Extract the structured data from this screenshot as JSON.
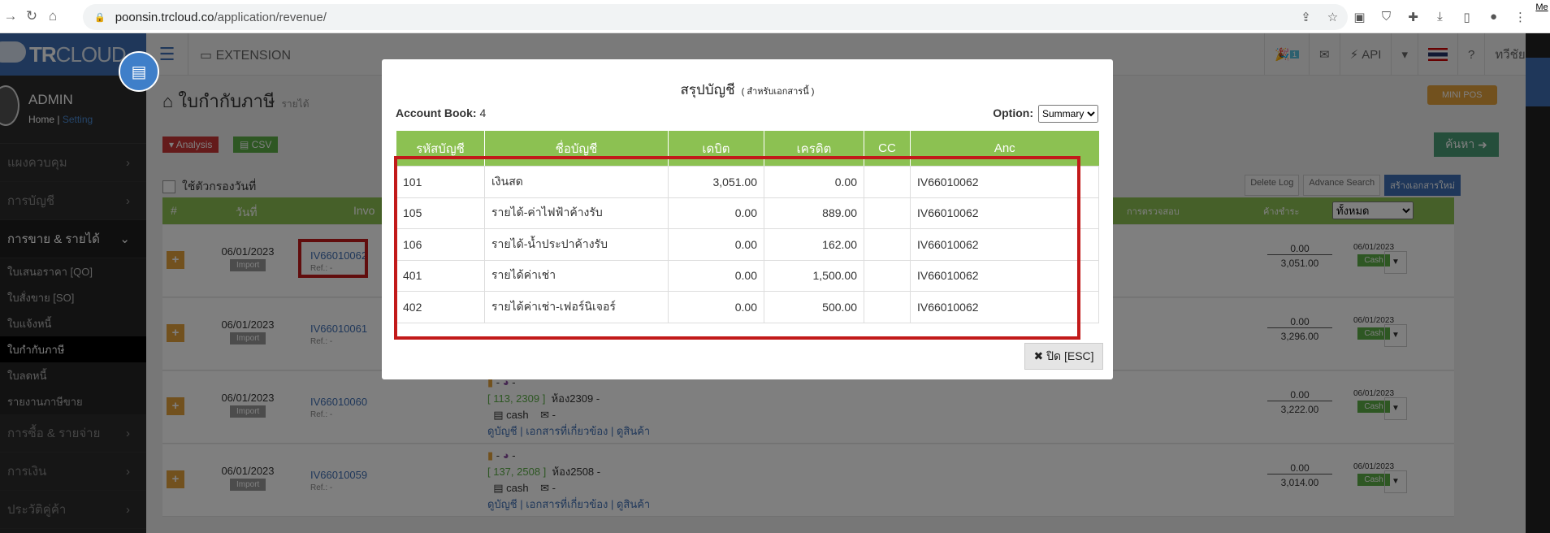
{
  "browser": {
    "url_host": "poonsin.trcloud.co",
    "url_path": "/application/revenue/",
    "me": "Me"
  },
  "app": {
    "logo_a": "TR",
    "logo_b": "CLOUD",
    "user": "ADMIN",
    "home": "Home",
    "setting": "Setting",
    "extension": "EXTENSION",
    "api": "API",
    "lang_user": "ทวีชัย",
    "badge": "1"
  },
  "sidebar": {
    "items": [
      "แผงควบคุม",
      "การบัญชี",
      "การขาย & รายได้"
    ],
    "subs": [
      "ใบเสนอราคา [QO]",
      "ใบสั่งขาย [SO]",
      "ใบแจ้งหนี้",
      "ใบกำกับภาษี",
      "ใบลดหนี้",
      "รายงานภาษีขาย"
    ],
    "items2": [
      "การซื้อ & รายจ่าย",
      "การเงิน",
      "ประวัติคู่ค้า"
    ]
  },
  "page": {
    "title": "ใบกำกับภาษี",
    "subtitle": "รายได้",
    "mini_pos": "MINI POS",
    "analysis": "Analysis",
    "csv": "CSV",
    "search": "ค้นหา",
    "date_filter": "ใช้ตัวกรองวันที่",
    "delete_log": "Delete Log",
    "adv_search": "Advance Search",
    "create": "สร้างเอกสารใหม่",
    "filter_all": "ทั้งหมด"
  },
  "table_head": {
    "hash": "#",
    "date": "วันที่",
    "inv": "Invo",
    "audit": "การตรวจสอบ",
    "due": "ค้างชำระ"
  },
  "rows": [
    {
      "date": "06/01/2023",
      "status": "Import",
      "inv": "IV66010062",
      "ref": "Ref.: -",
      "a": "0.00",
      "b": "3,051.00",
      "rdate": "06/01/2023",
      "pay": "Cash"
    },
    {
      "date": "06/01/2023",
      "status": "Import",
      "inv": "IV66010061",
      "ref": "Ref.: -",
      "a": "0.00",
      "b": "3,296.00",
      "rdate": "06/01/2023",
      "pay": "Cash"
    },
    {
      "date": "06/01/2023",
      "status": "Import",
      "inv": "IV66010060",
      "ref": "Ref.: -",
      "a": "0.00",
      "b": "3,222.00",
      "rdate": "06/01/2023",
      "pay": "Cash",
      "room": "[ 113, 2309 ]",
      "roomname": "ห้อง2309 -",
      "cash": "cash",
      "links": "ดูบัญชี | เอกสารที่เกี่ยวข้อง | ดูสินค้า"
    },
    {
      "date": "06/01/2023",
      "status": "Import",
      "inv": "IV66010059",
      "ref": "Ref.: -",
      "a": "0.00",
      "b": "3,014.00",
      "rdate": "06/01/2023",
      "pay": "Cash",
      "room": "[ 137, 2508 ]",
      "roomname": "ห้อง2508 -",
      "cash": "cash",
      "links": "ดูบัญชี | เอกสารที่เกี่ยวข้อง | ดูสินค้า"
    }
  ],
  "modal": {
    "title": "สรุปบัญชี",
    "title_note": "( สำหรับเอกสารนี้ )",
    "book_label": "Account Book:",
    "book_value": "4",
    "option_label": "Option:",
    "option_value": "Summary",
    "headers": [
      "รหัสบัญชี",
      "ชื่อบัญชี",
      "เดบิต",
      "เครดิต",
      "CC",
      "Anc"
    ],
    "rows": [
      [
        "101",
        "เงินสด",
        "3,051.00",
        "0.00",
        "",
        "IV66010062"
      ],
      [
        "105",
        "รายได้-ค่าไฟฟ้าค้างรับ",
        "0.00",
        "889.00",
        "",
        "IV66010062"
      ],
      [
        "106",
        "รายได้-น้ำประปาค้างรับ",
        "0.00",
        "162.00",
        "",
        "IV66010062"
      ],
      [
        "401",
        "รายได้ค่าเช่า",
        "0.00",
        "1,500.00",
        "",
        "IV66010062"
      ],
      [
        "402",
        "รายได้ค่าเช่า-เฟอร์นิเจอร์",
        "0.00",
        "500.00",
        "",
        "IV66010062"
      ]
    ],
    "close": "ปิด [ESC]"
  }
}
